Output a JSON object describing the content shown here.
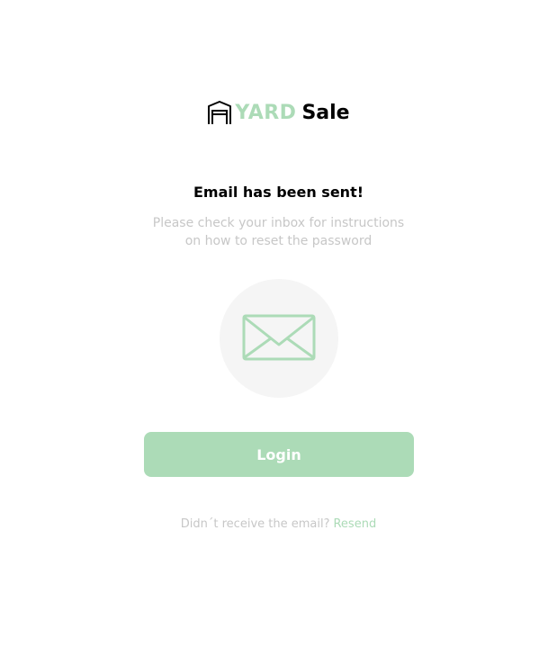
{
  "brand": {
    "yard": "YARD",
    "sale": "Sale",
    "accent_color": "#acdbb7",
    "logo_icon": "garage-icon"
  },
  "message": {
    "title": "Email has been sent!",
    "subtitle_line1": "Please check your inbox for instructions",
    "subtitle_line2": "on how to reset the password",
    "illustration_icon": "envelope-icon"
  },
  "actions": {
    "login_label": "Login",
    "resend_question": "Didn´t receive the email?",
    "resend_label": "Resend"
  },
  "colors": {
    "primary": "#acdbb7",
    "muted_text": "#c7c7c7",
    "circle_bg": "#f5f5f5"
  }
}
